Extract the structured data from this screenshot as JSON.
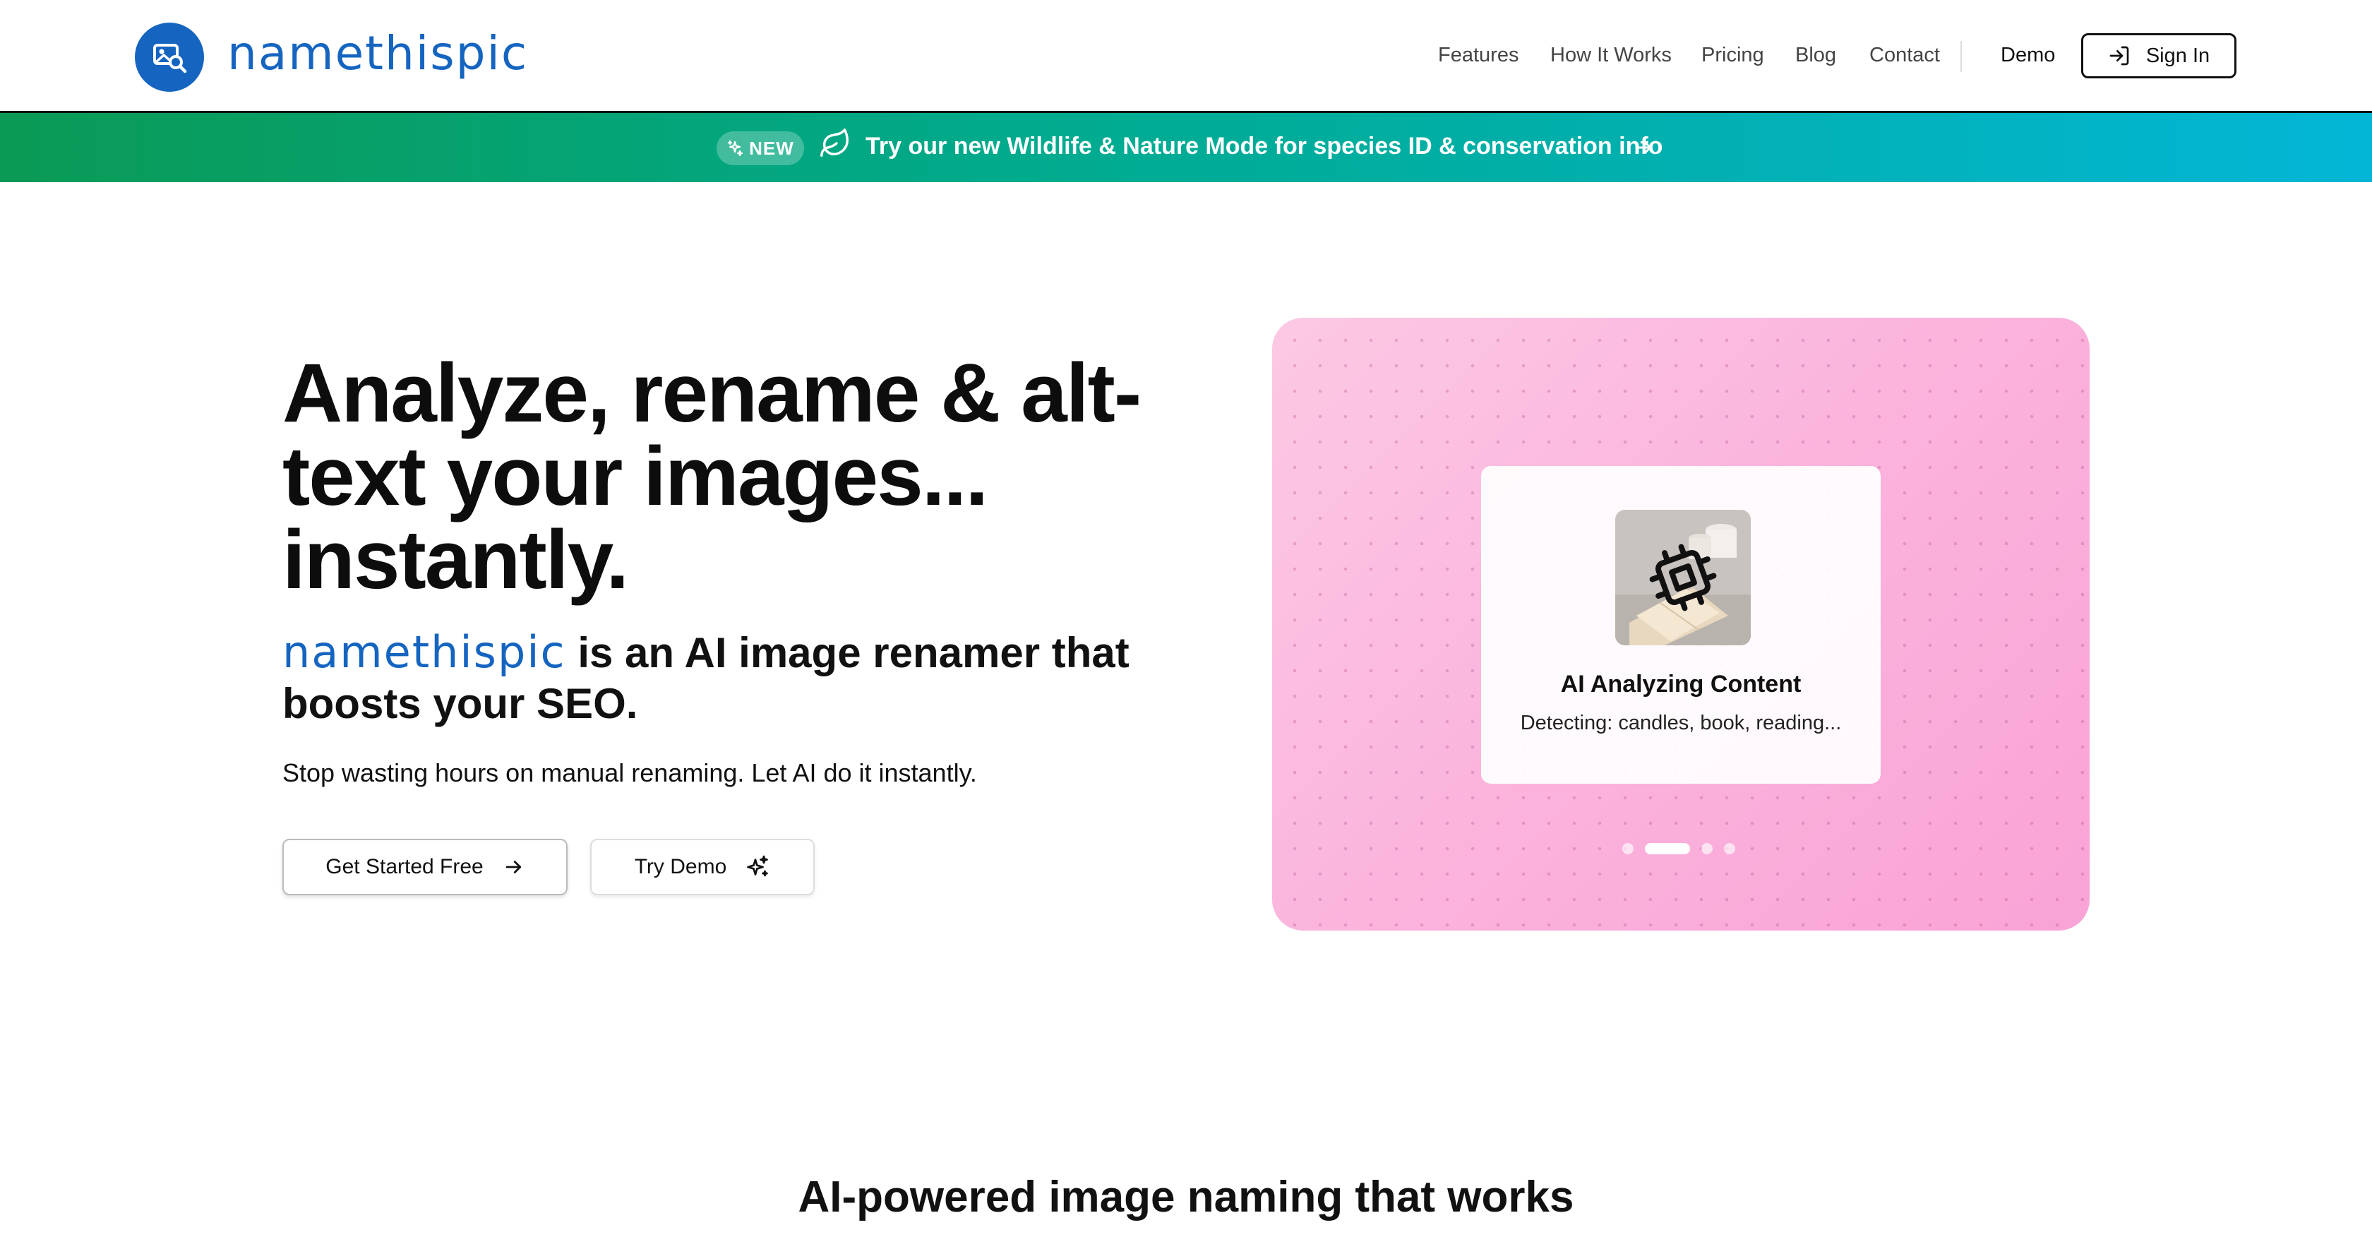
{
  "header": {
    "brand": "namethispic",
    "nav": [
      "Features",
      "How It Works",
      "Pricing",
      "Blog",
      "Contact"
    ],
    "demo": "Demo",
    "signin": "Sign In"
  },
  "banner": {
    "badge": "NEW",
    "text": "Try our new Wildlife & Nature Mode for species ID & conservation info"
  },
  "hero": {
    "headline": "Analyze, rename & alt-text your images... instantly.",
    "brand": "namethispic",
    "subhead": "is an AI image renamer that boosts your SEO.",
    "tagline": "Stop wasting hours on manual renaming. Let AI do it instantly.",
    "cta_primary": "Get Started Free",
    "cta_secondary": "Try Demo"
  },
  "showcase": {
    "card_title": "AI Analyzing Content",
    "card_subtitle": "Detecting: candles, book, reading...",
    "slide_count": 4,
    "active_slide": 2
  },
  "section": {
    "heading": "AI-powered image naming that works"
  },
  "colors": {
    "brand": "#1565c0",
    "banner_start": "#0a9a55",
    "banner_end": "#03b6d6",
    "showcase_pink": "#fbb3dc"
  }
}
